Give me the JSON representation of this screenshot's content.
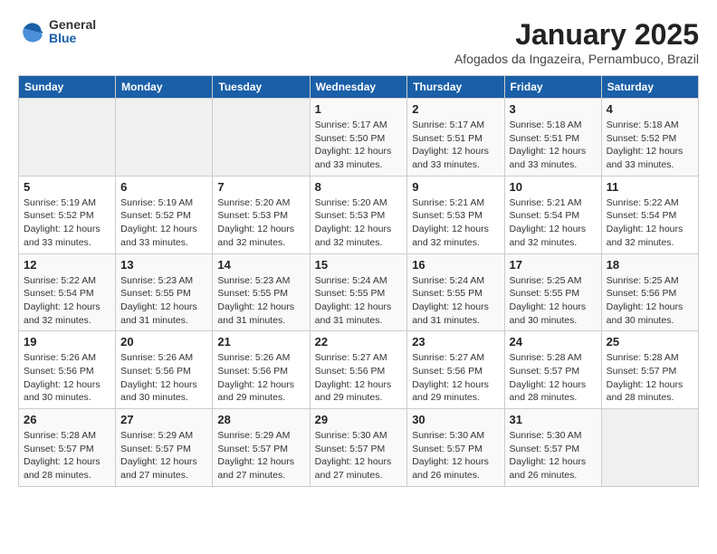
{
  "logo": {
    "general": "General",
    "blue": "Blue"
  },
  "title": "January 2025",
  "subtitle": "Afogados da Ingazeira, Pernambuco, Brazil",
  "days_of_week": [
    "Sunday",
    "Monday",
    "Tuesday",
    "Wednesday",
    "Thursday",
    "Friday",
    "Saturday"
  ],
  "weeks": [
    [
      {
        "day": "",
        "detail": ""
      },
      {
        "day": "",
        "detail": ""
      },
      {
        "day": "",
        "detail": ""
      },
      {
        "day": "1",
        "detail": "Sunrise: 5:17 AM\nSunset: 5:50 PM\nDaylight: 12 hours\nand 33 minutes."
      },
      {
        "day": "2",
        "detail": "Sunrise: 5:17 AM\nSunset: 5:51 PM\nDaylight: 12 hours\nand 33 minutes."
      },
      {
        "day": "3",
        "detail": "Sunrise: 5:18 AM\nSunset: 5:51 PM\nDaylight: 12 hours\nand 33 minutes."
      },
      {
        "day": "4",
        "detail": "Sunrise: 5:18 AM\nSunset: 5:52 PM\nDaylight: 12 hours\nand 33 minutes."
      }
    ],
    [
      {
        "day": "5",
        "detail": "Sunrise: 5:19 AM\nSunset: 5:52 PM\nDaylight: 12 hours\nand 33 minutes."
      },
      {
        "day": "6",
        "detail": "Sunrise: 5:19 AM\nSunset: 5:52 PM\nDaylight: 12 hours\nand 33 minutes."
      },
      {
        "day": "7",
        "detail": "Sunrise: 5:20 AM\nSunset: 5:53 PM\nDaylight: 12 hours\nand 32 minutes."
      },
      {
        "day": "8",
        "detail": "Sunrise: 5:20 AM\nSunset: 5:53 PM\nDaylight: 12 hours\nand 32 minutes."
      },
      {
        "day": "9",
        "detail": "Sunrise: 5:21 AM\nSunset: 5:53 PM\nDaylight: 12 hours\nand 32 minutes."
      },
      {
        "day": "10",
        "detail": "Sunrise: 5:21 AM\nSunset: 5:54 PM\nDaylight: 12 hours\nand 32 minutes."
      },
      {
        "day": "11",
        "detail": "Sunrise: 5:22 AM\nSunset: 5:54 PM\nDaylight: 12 hours\nand 32 minutes."
      }
    ],
    [
      {
        "day": "12",
        "detail": "Sunrise: 5:22 AM\nSunset: 5:54 PM\nDaylight: 12 hours\nand 32 minutes."
      },
      {
        "day": "13",
        "detail": "Sunrise: 5:23 AM\nSunset: 5:55 PM\nDaylight: 12 hours\nand 31 minutes."
      },
      {
        "day": "14",
        "detail": "Sunrise: 5:23 AM\nSunset: 5:55 PM\nDaylight: 12 hours\nand 31 minutes."
      },
      {
        "day": "15",
        "detail": "Sunrise: 5:24 AM\nSunset: 5:55 PM\nDaylight: 12 hours\nand 31 minutes."
      },
      {
        "day": "16",
        "detail": "Sunrise: 5:24 AM\nSunset: 5:55 PM\nDaylight: 12 hours\nand 31 minutes."
      },
      {
        "day": "17",
        "detail": "Sunrise: 5:25 AM\nSunset: 5:55 PM\nDaylight: 12 hours\nand 30 minutes."
      },
      {
        "day": "18",
        "detail": "Sunrise: 5:25 AM\nSunset: 5:56 PM\nDaylight: 12 hours\nand 30 minutes."
      }
    ],
    [
      {
        "day": "19",
        "detail": "Sunrise: 5:26 AM\nSunset: 5:56 PM\nDaylight: 12 hours\nand 30 minutes."
      },
      {
        "day": "20",
        "detail": "Sunrise: 5:26 AM\nSunset: 5:56 PM\nDaylight: 12 hours\nand 30 minutes."
      },
      {
        "day": "21",
        "detail": "Sunrise: 5:26 AM\nSunset: 5:56 PM\nDaylight: 12 hours\nand 29 minutes."
      },
      {
        "day": "22",
        "detail": "Sunrise: 5:27 AM\nSunset: 5:56 PM\nDaylight: 12 hours\nand 29 minutes."
      },
      {
        "day": "23",
        "detail": "Sunrise: 5:27 AM\nSunset: 5:56 PM\nDaylight: 12 hours\nand 29 minutes."
      },
      {
        "day": "24",
        "detail": "Sunrise: 5:28 AM\nSunset: 5:57 PM\nDaylight: 12 hours\nand 28 minutes."
      },
      {
        "day": "25",
        "detail": "Sunrise: 5:28 AM\nSunset: 5:57 PM\nDaylight: 12 hours\nand 28 minutes."
      }
    ],
    [
      {
        "day": "26",
        "detail": "Sunrise: 5:28 AM\nSunset: 5:57 PM\nDaylight: 12 hours\nand 28 minutes."
      },
      {
        "day": "27",
        "detail": "Sunrise: 5:29 AM\nSunset: 5:57 PM\nDaylight: 12 hours\nand 27 minutes."
      },
      {
        "day": "28",
        "detail": "Sunrise: 5:29 AM\nSunset: 5:57 PM\nDaylight: 12 hours\nand 27 minutes."
      },
      {
        "day": "29",
        "detail": "Sunrise: 5:30 AM\nSunset: 5:57 PM\nDaylight: 12 hours\nand 27 minutes."
      },
      {
        "day": "30",
        "detail": "Sunrise: 5:30 AM\nSunset: 5:57 PM\nDaylight: 12 hours\nand 26 minutes."
      },
      {
        "day": "31",
        "detail": "Sunrise: 5:30 AM\nSunset: 5:57 PM\nDaylight: 12 hours\nand 26 minutes."
      },
      {
        "day": "",
        "detail": ""
      }
    ]
  ]
}
